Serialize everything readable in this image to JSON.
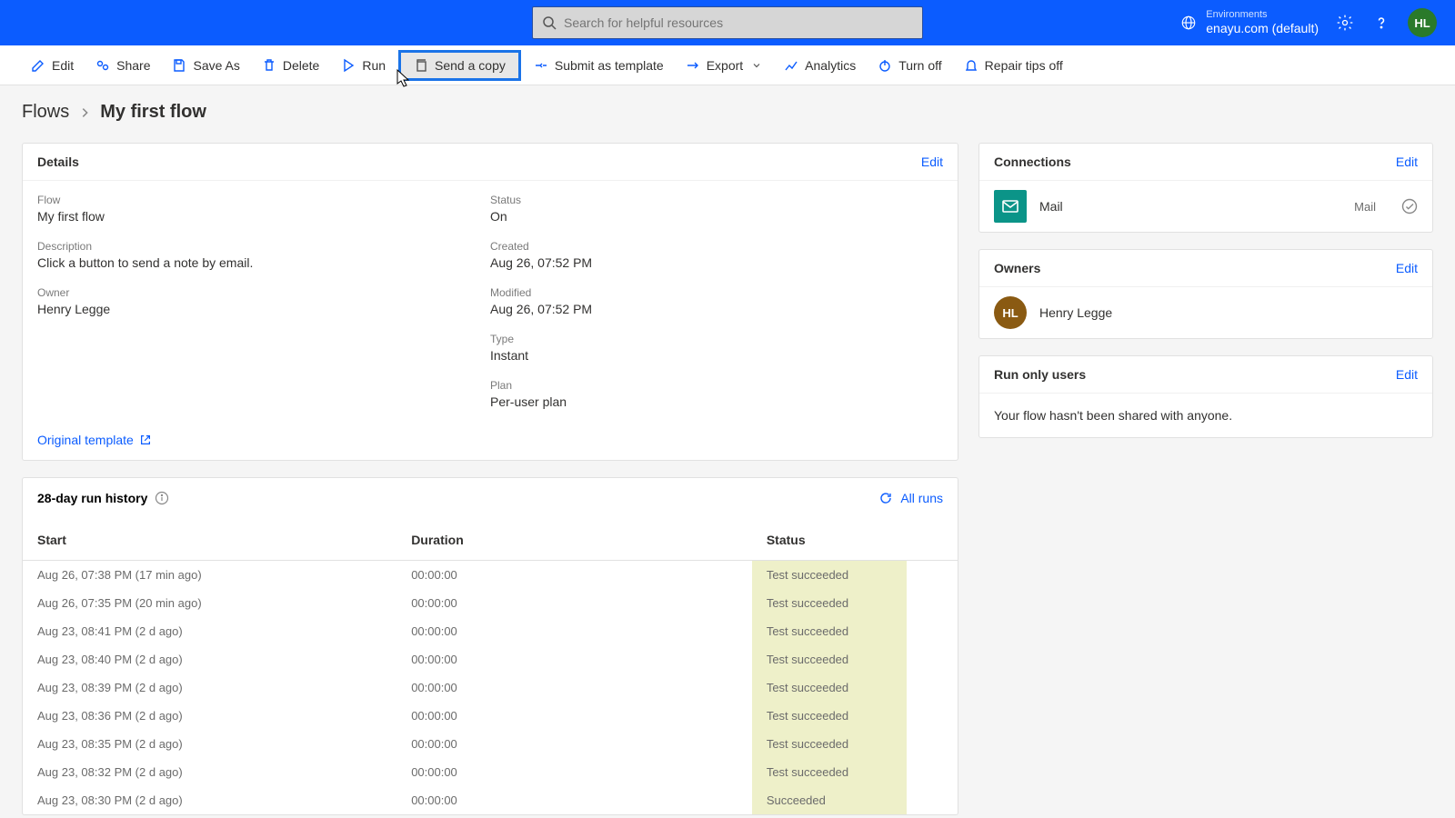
{
  "header": {
    "search_placeholder": "Search for helpful resources",
    "env_label": "Environments",
    "env_value": "enayu.com (default)",
    "avatar_initials": "HL"
  },
  "commands": {
    "edit": "Edit",
    "share": "Share",
    "save_as": "Save As",
    "delete": "Delete",
    "run": "Run",
    "send_copy": "Send a copy",
    "submit_template": "Submit as template",
    "export": "Export",
    "analytics": "Analytics",
    "turn_off": "Turn off",
    "repair_tips": "Repair tips off"
  },
  "breadcrumb": {
    "root": "Flows",
    "current": "My first flow"
  },
  "details": {
    "title": "Details",
    "edit": "Edit",
    "flow_label": "Flow",
    "flow_value": "My first flow",
    "description_label": "Description",
    "description_value": "Click a button to send a note by email.",
    "owner_label": "Owner",
    "owner_value": "Henry Legge",
    "status_label": "Status",
    "status_value": "On",
    "created_label": "Created",
    "created_value": "Aug 26, 07:52 PM",
    "modified_label": "Modified",
    "modified_value": "Aug 26, 07:52 PM",
    "type_label": "Type",
    "type_value": "Instant",
    "plan_label": "Plan",
    "plan_value": "Per-user plan",
    "template_link": "Original template"
  },
  "run_history": {
    "title": "28-day run history",
    "all_runs": "All runs",
    "columns": {
      "start": "Start",
      "duration": "Duration",
      "status": "Status"
    },
    "rows": [
      {
        "start": "Aug 26, 07:38 PM (17 min ago)",
        "duration": "00:00:00",
        "status": "Test succeeded"
      },
      {
        "start": "Aug 26, 07:35 PM (20 min ago)",
        "duration": "00:00:00",
        "status": "Test succeeded"
      },
      {
        "start": "Aug 23, 08:41 PM (2 d ago)",
        "duration": "00:00:00",
        "status": "Test succeeded"
      },
      {
        "start": "Aug 23, 08:40 PM (2 d ago)",
        "duration": "00:00:00",
        "status": "Test succeeded"
      },
      {
        "start": "Aug 23, 08:39 PM (2 d ago)",
        "duration": "00:00:00",
        "status": "Test succeeded"
      },
      {
        "start": "Aug 23, 08:36 PM (2 d ago)",
        "duration": "00:00:00",
        "status": "Test succeeded"
      },
      {
        "start": "Aug 23, 08:35 PM (2 d ago)",
        "duration": "00:00:00",
        "status": "Test succeeded"
      },
      {
        "start": "Aug 23, 08:32 PM (2 d ago)",
        "duration": "00:00:00",
        "status": "Test succeeded"
      },
      {
        "start": "Aug 23, 08:30 PM (2 d ago)",
        "duration": "00:00:00",
        "status": "Succeeded"
      }
    ]
  },
  "connections": {
    "title": "Connections",
    "edit": "Edit",
    "items": [
      {
        "name": "Mail",
        "type": "Mail"
      }
    ]
  },
  "owners": {
    "title": "Owners",
    "edit": "Edit",
    "initials": "HL",
    "name": "Henry Legge"
  },
  "run_only": {
    "title": "Run only users",
    "edit": "Edit",
    "message": "Your flow hasn't been shared with anyone."
  }
}
